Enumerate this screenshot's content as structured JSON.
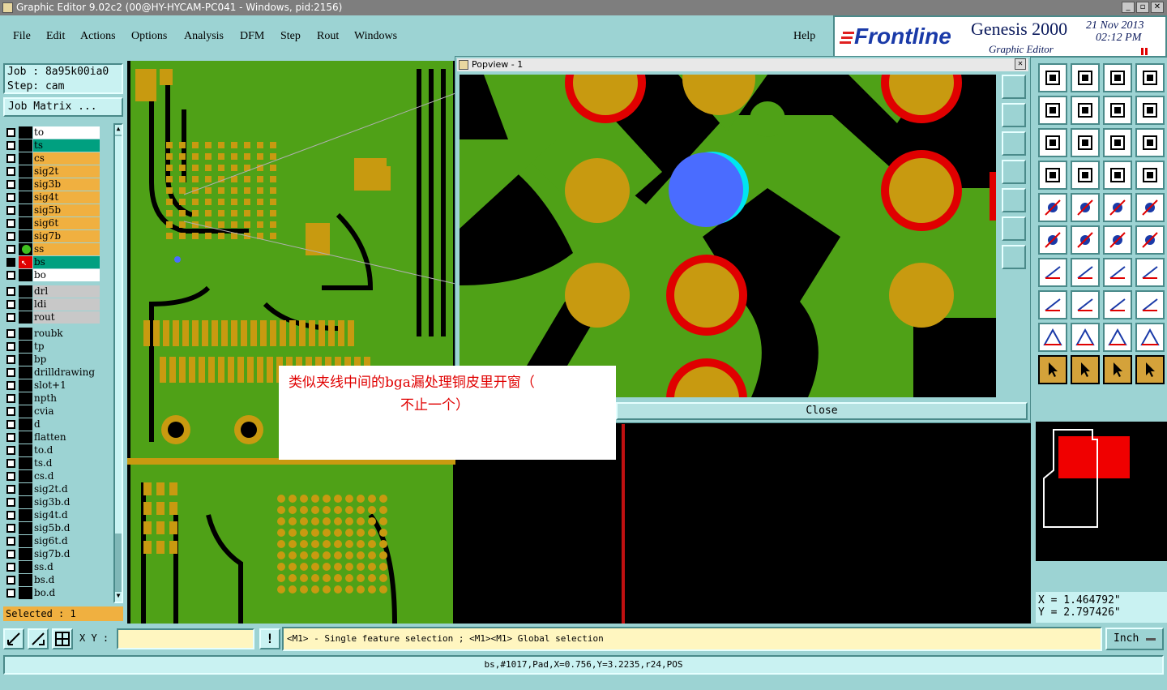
{
  "window": {
    "title": "Graphic Editor 9.02c2 (00@HY-HYCAM-PC041 - Windows, pid:2156)"
  },
  "menu": [
    "File",
    "Edit",
    "Actions",
    "Options",
    "Analysis",
    "DFM",
    "Step",
    "Rout",
    "Windows"
  ],
  "help_label": "Help",
  "logo": {
    "brand": "Frontline",
    "product": "Genesis 2000",
    "subtitle": "Graphic Editor",
    "date": "21 Nov 2013",
    "time": "02:12 PM"
  },
  "job": {
    "job_line": "Job : 8a95k00ia0",
    "step_line": "Step: cam",
    "matrix_button": "Job Matrix ..."
  },
  "layers": [
    {
      "name": "to",
      "bg": "#ffffff"
    },
    {
      "name": "ts",
      "bg": "#00a080"
    },
    {
      "name": "cs",
      "bg": "#f0b040"
    },
    {
      "name": "sig2t",
      "bg": "#f0b040"
    },
    {
      "name": "sig3b",
      "bg": "#f0b040"
    },
    {
      "name": "sig4t",
      "bg": "#f0b040"
    },
    {
      "name": "sig5b",
      "bg": "#f0b040"
    },
    {
      "name": "sig6t",
      "bg": "#f0b040"
    },
    {
      "name": "sig7b",
      "bg": "#f0b040"
    },
    {
      "name": "ss",
      "bg": "#f0b040"
    },
    {
      "name": "bs",
      "bg": "#00a080"
    },
    {
      "name": "bo",
      "bg": "#ffffff"
    },
    {
      "name": "drl",
      "bg": "#c8c8c8"
    },
    {
      "name": "ldi",
      "bg": "#c8c8c8"
    },
    {
      "name": "rout",
      "bg": "#c8c8c8"
    },
    {
      "name": "roubk",
      "bg": "#9cd3d3"
    },
    {
      "name": "tp",
      "bg": "#9cd3d3"
    },
    {
      "name": "bp",
      "bg": "#9cd3d3"
    },
    {
      "name": "drilldrawing",
      "bg": "#9cd3d3"
    },
    {
      "name": "slot+1",
      "bg": "#9cd3d3"
    },
    {
      "name": "npth",
      "bg": "#9cd3d3"
    },
    {
      "name": "cvia",
      "bg": "#9cd3d3"
    },
    {
      "name": "d",
      "bg": "#9cd3d3"
    },
    {
      "name": "flatten",
      "bg": "#9cd3d3"
    },
    {
      "name": "to.d",
      "bg": "#9cd3d3"
    },
    {
      "name": "ts.d",
      "bg": "#9cd3d3"
    },
    {
      "name": "cs.d",
      "bg": "#9cd3d3"
    },
    {
      "name": "sig2t.d",
      "bg": "#9cd3d3"
    },
    {
      "name": "sig3b.d",
      "bg": "#9cd3d3"
    },
    {
      "name": "sig4t.d",
      "bg": "#9cd3d3"
    },
    {
      "name": "sig5b.d",
      "bg": "#9cd3d3"
    },
    {
      "name": "sig6t.d",
      "bg": "#9cd3d3"
    },
    {
      "name": "sig7b.d",
      "bg": "#9cd3d3"
    },
    {
      "name": "ss.d",
      "bg": "#9cd3d3"
    },
    {
      "name": "bs.d",
      "bg": "#9cd3d3"
    },
    {
      "name": "bo.d",
      "bg": "#9cd3d3"
    }
  ],
  "selected": "Selected : 1",
  "popup": {
    "title": "Popview - 1",
    "close_label": "Close"
  },
  "note": {
    "line1": "类似夹线中间的bga漏处理铜皮里开窗（",
    "line2": "不止一个）"
  },
  "coords": {
    "x": "X = 1.464792\"",
    "y": "Y = 2.797426\""
  },
  "bottom": {
    "xy_label": "X Y :",
    "xy_value": "",
    "hint": "<M1> - Single feature selection ; <M1><M1> Global selection",
    "units": "Inch"
  },
  "status": "bs,#1017,Pad,X=0.756,Y=3.2235,r24,POS",
  "colors": {
    "copper": "#4fa117",
    "pad": "#c89a10",
    "mask": "#e00000",
    "highlight": "#4a6cff"
  }
}
